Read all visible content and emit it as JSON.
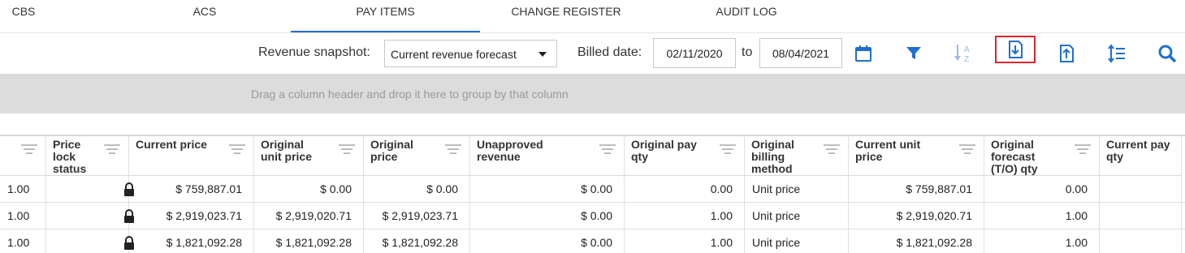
{
  "tabs": [
    {
      "label": "CBS",
      "active": false
    },
    {
      "label": "ACS",
      "active": false
    },
    {
      "label": "PAY ITEMS",
      "active": true
    },
    {
      "label": "CHANGE REGISTER",
      "active": false
    },
    {
      "label": "AUDIT LOG",
      "active": false
    }
  ],
  "toolbar": {
    "revenue_label": "Revenue snapshot:",
    "revenue_value": "Current revenue forecast",
    "billed_label": "Billed date:",
    "date_from": "02/11/2020",
    "to_label": "to",
    "date_to": "08/04/2021",
    "icons": [
      "calendar-icon",
      "filter-icon",
      "sort-az-icon",
      "export-icon",
      "import-icon",
      "line-spacing-icon",
      "search-icon"
    ],
    "accent_color": "#1f6fd1",
    "selected_border_color": "#d9262c"
  },
  "group_panel": {
    "hint": "Drag a column header and drop it here to group by that column"
  },
  "grid": {
    "columns": [
      {
        "label": ""
      },
      {
        "label": "Price\nlock\nstatus"
      },
      {
        "label": "Current price"
      },
      {
        "label": "Original\nunit price"
      },
      {
        "label": "Original\nprice"
      },
      {
        "label": "Unapproved\nrevenue"
      },
      {
        "label": "Original pay\nqty"
      },
      {
        "label": "Original\nbilling\nmethod"
      },
      {
        "label": "Current unit\nprice"
      },
      {
        "label": "Original\nforecast\n(T/O) qty"
      },
      {
        "label": "Current pay\nqty"
      }
    ],
    "rows": [
      {
        "c0": "1.00",
        "locked": true,
        "current_price": "$ 759,887.01",
        "orig_unit_price": "$ 0.00",
        "orig_price": "$ 0.00",
        "unapproved": "$ 0.00",
        "orig_pay_qty": "0.00",
        "billing": "Unit price",
        "cur_unit_price": "$ 759,887.01",
        "forecast_qty": "0.00",
        "cur_pay_qty": ""
      },
      {
        "c0": "1.00",
        "locked": true,
        "current_price": "$ 2,919,023.71",
        "orig_unit_price": "$ 2,919,020.71",
        "orig_price": "$ 2,919,023.71",
        "unapproved": "$ 0.00",
        "orig_pay_qty": "1.00",
        "billing": "Unit price",
        "cur_unit_price": "$ 2,919,020.71",
        "forecast_qty": "1.00",
        "cur_pay_qty": ""
      },
      {
        "c0": "1.00",
        "locked": true,
        "current_price": "$ 1,821,092.28",
        "orig_unit_price": "$ 1,821,092.28",
        "orig_price": "$ 1,821,092.28",
        "unapproved": "$ 0.00",
        "orig_pay_qty": "1.00",
        "billing": "Unit price",
        "cur_unit_price": "$ 1,821,092.28",
        "forecast_qty": "1.00",
        "cur_pay_qty": ""
      }
    ]
  }
}
